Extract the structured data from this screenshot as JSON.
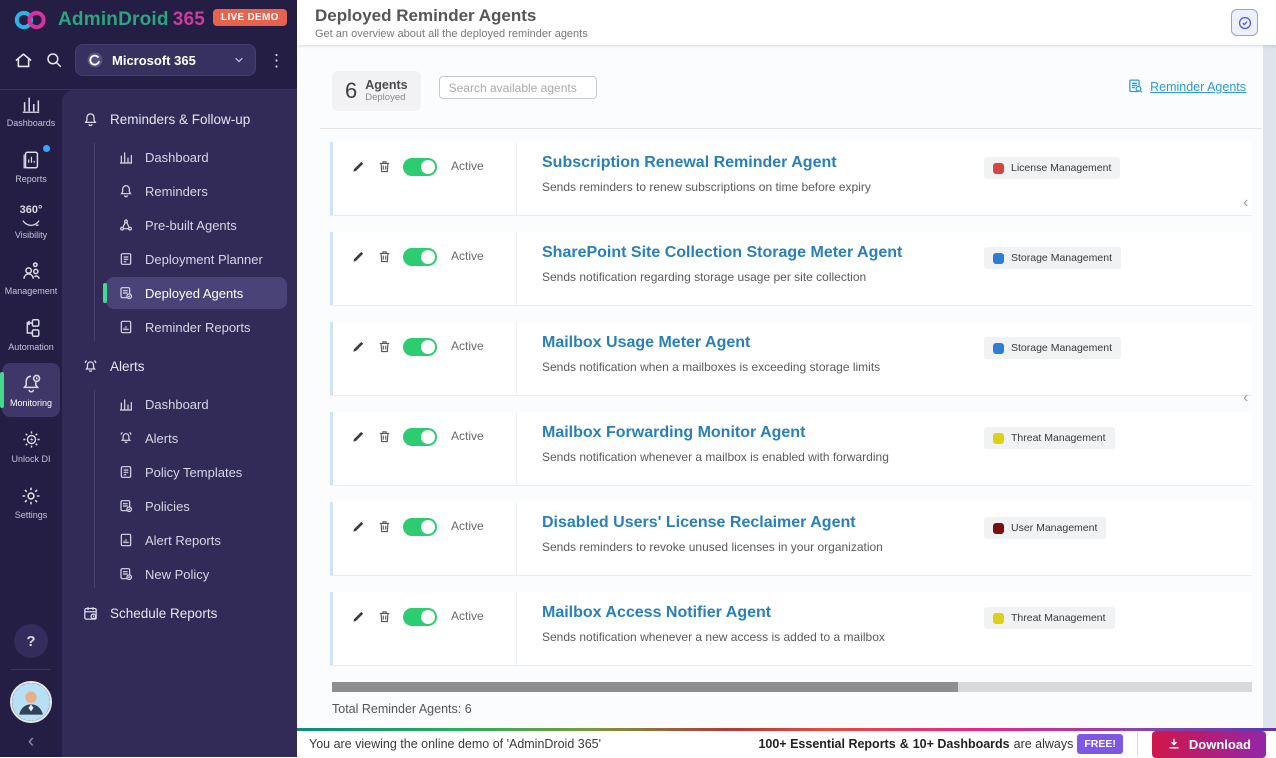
{
  "brand": {
    "name": "AdminDroid",
    "suffix": "365",
    "live_badge": "LIVE DEMO"
  },
  "topbar": {
    "workspace": "Microsoft 365"
  },
  "rail": {
    "items": [
      {
        "label": "Dashboards",
        "icon": "bar-chart-icon"
      },
      {
        "label": "Reports",
        "icon": "reports-icon"
      },
      {
        "label": "Visibility",
        "icon": "visibility-360-icon",
        "icon_text": "360°"
      },
      {
        "label": "Management",
        "icon": "management-icon"
      },
      {
        "label": "Automation",
        "icon": "automation-icon"
      },
      {
        "label": "Monitoring",
        "icon": "monitoring-bell-icon",
        "active": true
      },
      {
        "label": "Unlock DI",
        "icon": "unlock-di-icon"
      },
      {
        "label": "Settings",
        "icon": "settings-gear-icon"
      }
    ],
    "help_glyph": "?"
  },
  "sidebar": {
    "sections": [
      {
        "title": "Reminders & Follow-up",
        "items": [
          {
            "label": "Dashboard",
            "icon": "bar-chart-icon"
          },
          {
            "label": "Reminders",
            "icon": "bell-icon"
          },
          {
            "label": "Pre-built Agents",
            "icon": "network-icon"
          },
          {
            "label": "Deployment Planner",
            "icon": "document-icon"
          },
          {
            "label": "Deployed Agents",
            "icon": "document-check-icon",
            "active": true
          },
          {
            "label": "Reminder Reports",
            "icon": "report-icon"
          }
        ]
      },
      {
        "title": "Alerts",
        "items": [
          {
            "label": "Dashboard",
            "icon": "bar-chart-icon"
          },
          {
            "label": "Alerts",
            "icon": "bell-ring-icon"
          },
          {
            "label": "Policy Templates",
            "icon": "document-icon"
          },
          {
            "label": "Policies",
            "icon": "document-check-icon"
          },
          {
            "label": "Alert Reports",
            "icon": "report-icon"
          },
          {
            "label": "New Policy",
            "icon": "document-plus-icon"
          }
        ]
      }
    ],
    "bottom_item": "Schedule Reports"
  },
  "header": {
    "title": "Deployed Reminder Agents",
    "subtitle": "Get an overview about all the deployed reminder agents"
  },
  "toolbar": {
    "count": "6",
    "count_label": "Agents",
    "count_sublabel": "Deployed",
    "search_placeholder": "Search available agents",
    "link_label": "Reminder Agents"
  },
  "agents": [
    {
      "name": "Subscription Renewal Reminder Agent",
      "description": "Sends reminders to renew subscriptions on time before expiry",
      "status": "Active",
      "category": "License Management",
      "dot_color": "#d64541",
      "dot_style": "background:#d64541"
    },
    {
      "name": "SharePoint Site Collection Storage Meter Agent",
      "description": "Sends notification regarding storage usage per site collection",
      "status": "Active",
      "category": "Storage Management",
      "dot_color": "#2d7ed3",
      "dot_style": "background:#2d7ed3"
    },
    {
      "name": "Mailbox Usage Meter Agent",
      "description": "Sends notification when a mailboxes is exceeding storage limits",
      "status": "Active",
      "category": "Storage Management",
      "dot_color": "#2d7ed3",
      "dot_style": "background:#2d7ed3"
    },
    {
      "name": "Mailbox Forwarding Monitor Agent",
      "description": "Sends notification whenever a mailbox is enabled with forwarding",
      "status": "Active",
      "category": "Threat Management",
      "dot_color": "#ddd016",
      "dot_style": "background:#ddd016"
    },
    {
      "name": "Disabled Users' License Reclaimer Agent",
      "description": "Sends reminders to revoke unused licenses in your organization",
      "status": "Active",
      "category": "User Management",
      "dot_color": "#7a0f0f",
      "dot_style": "background:#7a0f0f"
    },
    {
      "name": "Mailbox Access Notifier Agent",
      "description": "Sends notification whenever a new access is added to a mailbox",
      "status": "Active",
      "category": "Threat Management",
      "dot_color": "#ddd016",
      "dot_style": "background:#ddd016"
    }
  ],
  "list": {
    "total": "Total Reminder Agents: 6",
    "collapse_glyph": "‹"
  },
  "footer": {
    "demo_text": "You are viewing the online demo of 'AdminDroid 365'",
    "promo_bold1": "100+ Essential Reports",
    "promo_amp": "&",
    "promo_bold2": "10+ Dashboards",
    "promo_tail": "are always",
    "free_badge": "FREE!",
    "download_label": "Download"
  },
  "icons": {
    "infinity-logo-icon": "two overlapping rings",
    "home-icon": "house outline",
    "search-icon": "magnifier",
    "kebab-menu-icon": "⋮",
    "chevron-down-icon": "v",
    "clock-check-icon": "clock in rounded square",
    "doc-search-icon": "document with magnifier",
    "pencil-icon": "edit pen",
    "trash-icon": "waste bin",
    "chevron-left-icon": "‹",
    "download-icon": "arrow into tray",
    "question-icon": "?"
  }
}
